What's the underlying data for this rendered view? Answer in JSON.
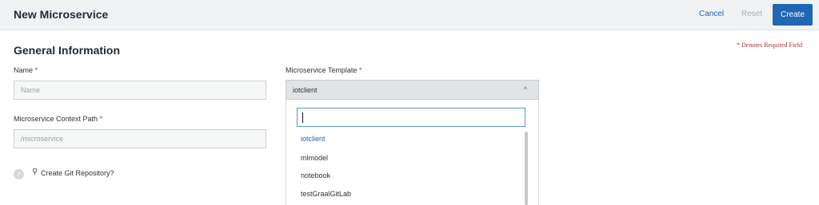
{
  "header": {
    "title": "New Microservice",
    "cancel_label": "Cancel",
    "reset_label": "Reset",
    "create_label": "Create"
  },
  "form": {
    "required_note": "* Denotes Required Field",
    "section_title": "General Information",
    "name_label": "Name",
    "name_placeholder": "Name",
    "template_label": "Microservice Template",
    "template_value": "iotclient",
    "context_label": "Microservice Context Path",
    "context_placeholder": "/microservice",
    "git_label": "Create Git Repository?",
    "required_mark": "*"
  },
  "dropdown": {
    "search_value": "",
    "options": [
      "iotclient",
      "mlmodel",
      "notebook",
      "testGraalGitLab"
    ],
    "selected": "iotclient"
  },
  "colors": {
    "accent": "#1f66b3",
    "required": "#c0392b"
  },
  "icons": {
    "chevron": "chevron-up-icon",
    "check": "check-icon",
    "bulb": "lightbulb-icon"
  }
}
